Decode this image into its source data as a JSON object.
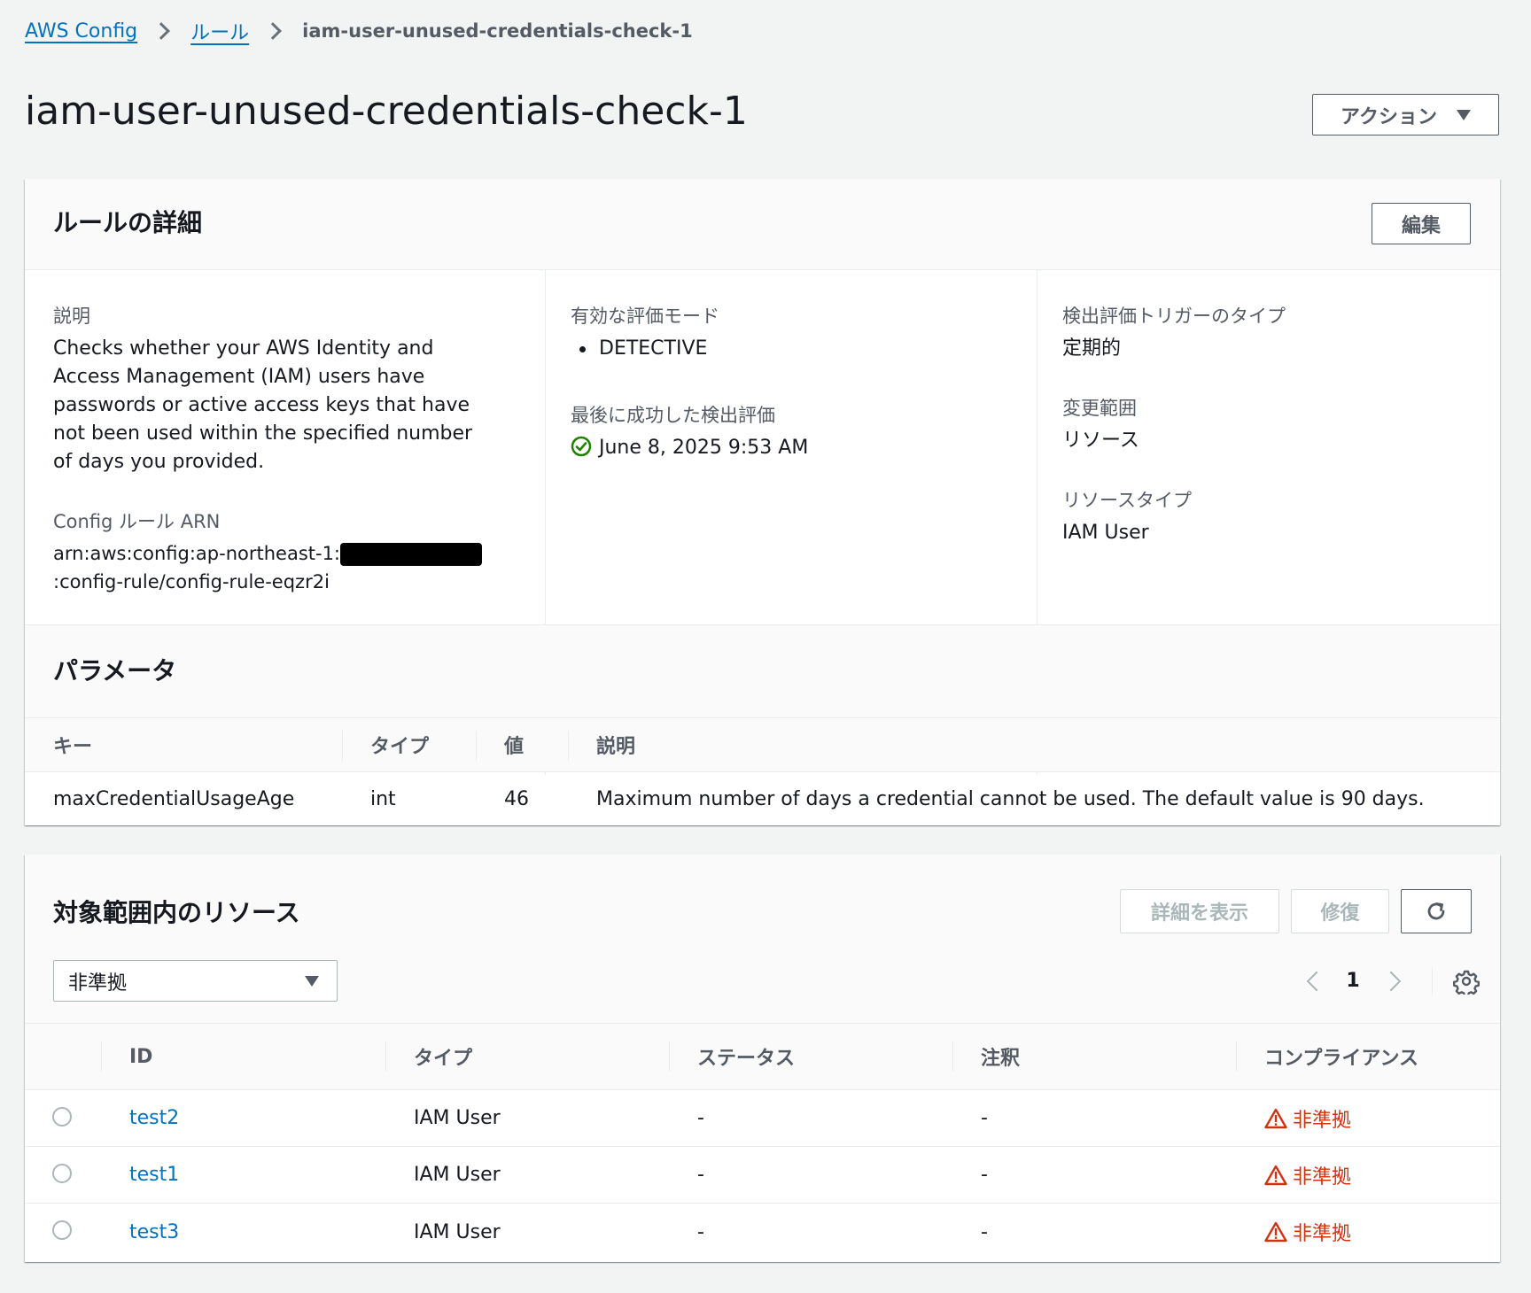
{
  "breadcrumb": {
    "items": [
      "AWS Config",
      "ルール"
    ],
    "current": "iam-user-unused-credentials-check-1"
  },
  "header": {
    "title": "iam-user-unused-credentials-check-1",
    "actions_label": "アクション"
  },
  "rule_details": {
    "title": "ルールの詳細",
    "edit_label": "編集",
    "description_label": "説明",
    "description": "Checks whether your AWS Identity and Access Management (IAM) users have passwords or active access keys that have not been used within the specified number of days you provided.",
    "arn_label": "Config ルール ARN",
    "arn_prefix": "arn:aws:config:ap-northeast-1:",
    "arn_suffix": ":config-rule/config-rule-eqzr2i",
    "eval_mode_label": "有効な評価モード",
    "eval_mode": "DETECTIVE",
    "last_success_label": "最後に成功した検出評価",
    "last_success": "June 8, 2025 9:53 AM",
    "trigger_type_label": "検出評価トリガーのタイプ",
    "trigger_type": "定期的",
    "scope_label": "変更範囲",
    "scope": "リソース",
    "resource_type_label": "リソースタイプ",
    "resource_type": "IAM User"
  },
  "parameters": {
    "title": "パラメータ",
    "headers": [
      "キー",
      "タイプ",
      "値",
      "説明"
    ],
    "rows": [
      {
        "key": "maxCredentialUsageAge",
        "type": "int",
        "value": "46",
        "description": "Maximum number of days a credential cannot be used. The default value is 90 days."
      }
    ]
  },
  "resources": {
    "title": "対象範囲内のリソース",
    "details_label": "詳細を表示",
    "remediate_label": "修復",
    "filter_value": "非準拠",
    "page": "1",
    "headers": [
      "ID",
      "タイプ",
      "ステータス",
      "注釈",
      "コンプライアンス"
    ],
    "rows": [
      {
        "id": "test2",
        "type": "IAM User",
        "status": "-",
        "annotation": "-",
        "compliance": "非準拠"
      },
      {
        "id": "test1",
        "type": "IAM User",
        "status": "-",
        "annotation": "-",
        "compliance": "非準拠"
      },
      {
        "id": "test3",
        "type": "IAM User",
        "status": "-",
        "annotation": "-",
        "compliance": "非準拠"
      }
    ]
  },
  "colors": {
    "link": "#0073bb",
    "noncompliant": "#d13212",
    "success": "#1d8102"
  },
  "icons": [
    "chevron-right-icon",
    "caret-down-icon",
    "check-circle-icon",
    "refresh-icon",
    "chevron-left-icon",
    "gear-icon",
    "warning-icon"
  ]
}
